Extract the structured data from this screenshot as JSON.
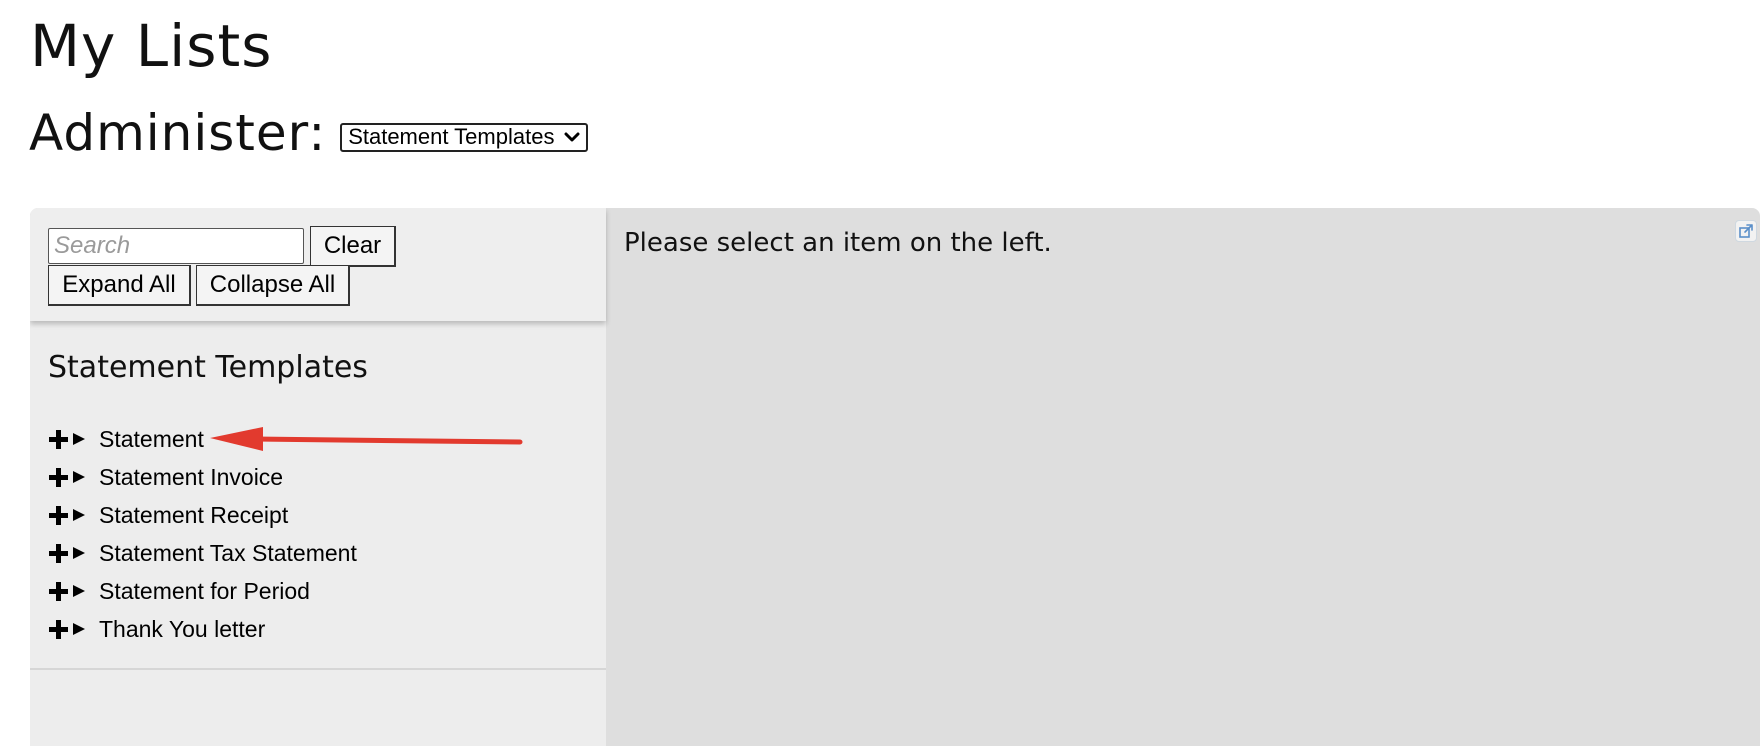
{
  "page": {
    "title": "My Lists"
  },
  "administer": {
    "label": "Administer:",
    "selected": "Statement Templates"
  },
  "toolbar": {
    "search_placeholder": "Search",
    "clear_label": "Clear",
    "expand_all_label": "Expand All",
    "collapse_all_label": "Collapse All"
  },
  "tree": {
    "heading": "Statement Templates",
    "items": [
      {
        "label": "Statement"
      },
      {
        "label": "Statement Invoice"
      },
      {
        "label": "Statement Receipt"
      },
      {
        "label": "Statement Tax Statement"
      },
      {
        "label": "Statement for Period"
      },
      {
        "label": "Thank You letter"
      }
    ]
  },
  "main": {
    "message": "Please select an item on the left."
  },
  "icons": {
    "expand": "plus-icon",
    "caret": "triangle-right-icon",
    "dropdown": "chevron-down-icon",
    "popout": "popout-icon",
    "annotation": "red-arrow-annotation"
  },
  "colors": {
    "annotation_red": "#e23a2e",
    "sidebar_bg": "#ededed",
    "main_bg": "#dedede"
  }
}
